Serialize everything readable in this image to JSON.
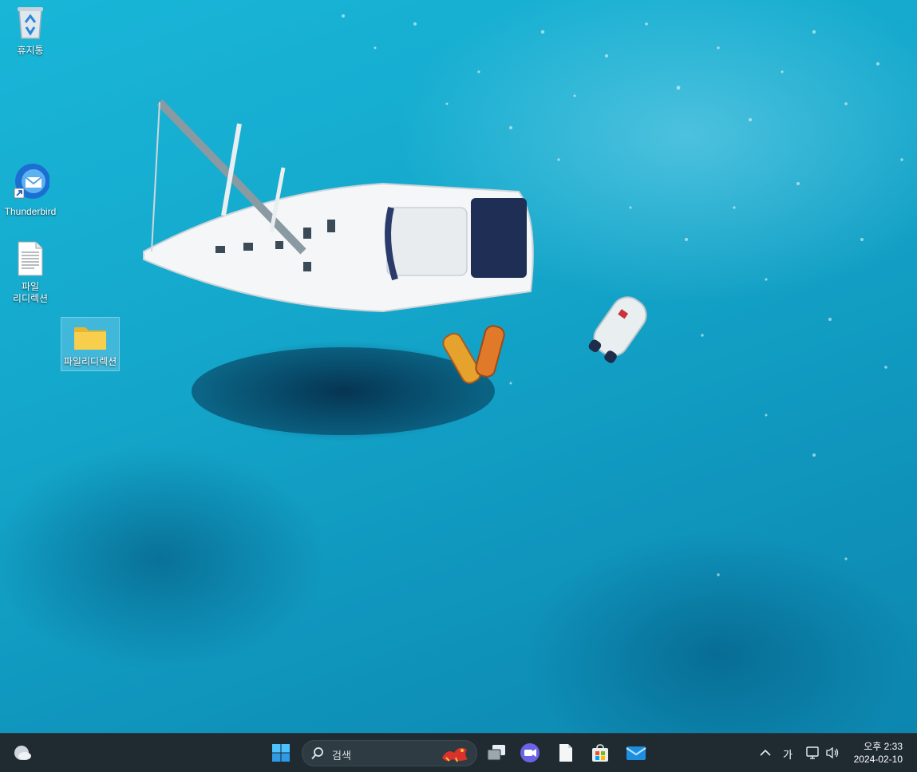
{
  "desktop": {
    "wallpaper": "aerial-sailboat-turquoise-sea",
    "icons": [
      {
        "label": "휴지통",
        "icon": "recycle-bin-icon"
      },
      {
        "label": "Thunderbird",
        "icon": "thunderbird-icon",
        "shortcut": true
      },
      {
        "label": "파일\n리디렉션",
        "icon": "text-document-icon"
      },
      {
        "label": "파일리디렉션",
        "icon": "folder-icon",
        "selected": true
      }
    ]
  },
  "taskbar": {
    "widgets_icon": "weather-icon",
    "start_icon": "windows-start-icon",
    "search": {
      "placeholder": "검색",
      "highlight_icon": "dragon-icon"
    },
    "pinned": [
      "task-view-icon",
      "video-chat-icon",
      "notepad-icon",
      "store-icon",
      "mail-icon"
    ],
    "tray": {
      "chevron_icon": "chevron-up-icon",
      "ime": "가",
      "network_icon": "network-icon",
      "volume_icon": "volume-icon",
      "time": "오후 2:33",
      "date": "2024-02-10"
    }
  },
  "colors": {
    "sea": "#14a7cb",
    "taskbar": "#1f2a31",
    "accent": "#3aa0e8"
  }
}
